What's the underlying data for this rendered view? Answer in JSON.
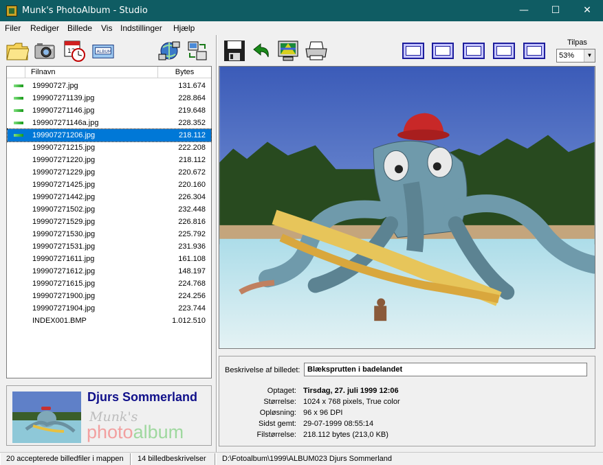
{
  "window": {
    "title": "Munk's PhotoAlbum - Studio",
    "minimize": "—",
    "maximize": "☐",
    "close": "✕"
  },
  "menu": [
    {
      "label": "Filer"
    },
    {
      "label": "Rediger"
    },
    {
      "label": "Billede"
    },
    {
      "label": "Vis"
    },
    {
      "label": "Indstillinger"
    },
    {
      "label": "Hjælp"
    }
  ],
  "toolbar": {
    "left_icons": [
      "folder-icon",
      "camera-icon",
      "calendar-clock-icon",
      "album-icon",
      "network-icon",
      "transfer-icon"
    ],
    "album_icon_text": "ALBUM",
    "right_icons": [
      "save-icon",
      "undo-icon",
      "monitor-icon",
      "printer-icon"
    ],
    "layout_icons": [
      "layout-1-icon",
      "layout-2-icon",
      "layout-3-icon",
      "layout-4-icon",
      "layout-5-icon"
    ]
  },
  "zoom": {
    "label": "Tilpas",
    "value": "53%"
  },
  "filelist": {
    "columns": {
      "name": "Filnavn",
      "bytes": "Bytes"
    },
    "rows": [
      {
        "name": "19990727.jpg",
        "bytes": "131.674",
        "marked": true,
        "selected": false
      },
      {
        "name": "199907271139.jpg",
        "bytes": "228.864",
        "marked": true,
        "selected": false
      },
      {
        "name": "199907271146.jpg",
        "bytes": "219.648",
        "marked": true,
        "selected": false
      },
      {
        "name": "199907271146a.jpg",
        "bytes": "228.352",
        "marked": true,
        "selected": false
      },
      {
        "name": "199907271206.jpg",
        "bytes": "218.112",
        "marked": true,
        "selected": true
      },
      {
        "name": "199907271215.jpg",
        "bytes": "222.208",
        "marked": false,
        "selected": false
      },
      {
        "name": "199907271220.jpg",
        "bytes": "218.112",
        "marked": false,
        "selected": false
      },
      {
        "name": "199907271229.jpg",
        "bytes": "220.672",
        "marked": false,
        "selected": false
      },
      {
        "name": "199907271425.jpg",
        "bytes": "220.160",
        "marked": false,
        "selected": false
      },
      {
        "name": "199907271442.jpg",
        "bytes": "226.304",
        "marked": false,
        "selected": false
      },
      {
        "name": "199907271502.jpg",
        "bytes": "232.448",
        "marked": false,
        "selected": false
      },
      {
        "name": "199907271529.jpg",
        "bytes": "226.816",
        "marked": false,
        "selected": false
      },
      {
        "name": "199907271530.jpg",
        "bytes": "225.792",
        "marked": false,
        "selected": false
      },
      {
        "name": "199907271531.jpg",
        "bytes": "231.936",
        "marked": false,
        "selected": false
      },
      {
        "name": "199907271611.jpg",
        "bytes": "161.108",
        "marked": false,
        "selected": false
      },
      {
        "name": "199907271612.jpg",
        "bytes": "148.197",
        "marked": false,
        "selected": false
      },
      {
        "name": "199907271615.jpg",
        "bytes": "224.768",
        "marked": false,
        "selected": false
      },
      {
        "name": "199907271900.jpg",
        "bytes": "224.256",
        "marked": false,
        "selected": false
      },
      {
        "name": "199907271904.jpg",
        "bytes": "223.744",
        "marked": false,
        "selected": false
      },
      {
        "name": "INDEX001.BMP",
        "bytes": "1.012.510",
        "marked": false,
        "selected": false
      }
    ]
  },
  "album": {
    "title": "Djurs Sommerland",
    "logo_line1": "Munk's",
    "logo_photo": "photo",
    "logo_album": "album"
  },
  "description": {
    "label": "Beskrivelse af billedet:",
    "value": "Blæksprutten i badelandet",
    "info": [
      {
        "key": "Optaget:",
        "value": "Tirsdag, 27. juli 1999  12:06",
        "bold": true
      },
      {
        "key": "Størrelse:",
        "value": "1024 x 768 pixels, True color",
        "bold": false
      },
      {
        "key": "Opløsning:",
        "value": "96 x 96 DPI",
        "bold": false
      },
      {
        "key": "Sidst gemt:",
        "value": "29-07-1999 08:55:14",
        "bold": false
      },
      {
        "key": "Filstørrelse:",
        "value": "218.112 bytes (213,0 KB)",
        "bold": false
      }
    ]
  },
  "status": {
    "accepted": "20 accepterede billedfiler i mappen",
    "descriptions": "14 billedbeskrivelser",
    "path": "D:\\Fotoalbum\\1999\\ALBUM023 Djurs Sommerland"
  }
}
